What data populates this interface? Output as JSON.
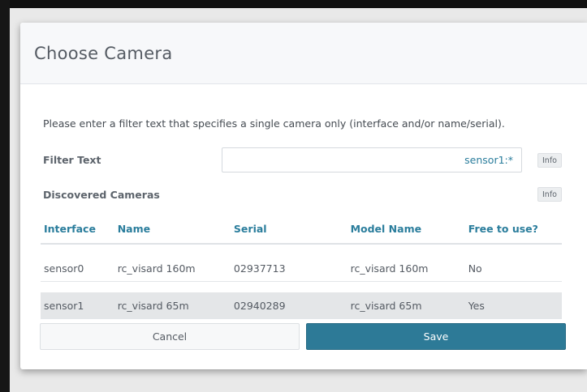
{
  "dialog": {
    "title": "Choose Camera",
    "intro": "Please enter a filter text that specifies a single camera only (interface and/or name/serial).",
    "filter_label": "Filter Text",
    "filter_value": "sensor1:*",
    "info_label": "Info",
    "discovered_label": "Discovered Cameras"
  },
  "table": {
    "headers": [
      "Interface",
      "Name",
      "Serial",
      "Model Name",
      "Free to use?"
    ],
    "rows": [
      {
        "interface": "sensor0",
        "name": "rc_visard 160m",
        "serial": "02937713",
        "model": "rc_visard 160m",
        "free": "No",
        "selected": false
      },
      {
        "interface": "sensor1",
        "name": "rc_visard 65m",
        "serial": "02940289",
        "model": "rc_visard 65m",
        "free": "Yes",
        "selected": true
      }
    ]
  },
  "buttons": {
    "cancel_label": "Cancel",
    "save_label": "Save"
  },
  "colors": {
    "accent": "#2a7d9c",
    "save_button": "#2d7a97",
    "selected_row": "#e4e6e8"
  },
  "icons": {
    "info": "info-button"
  }
}
